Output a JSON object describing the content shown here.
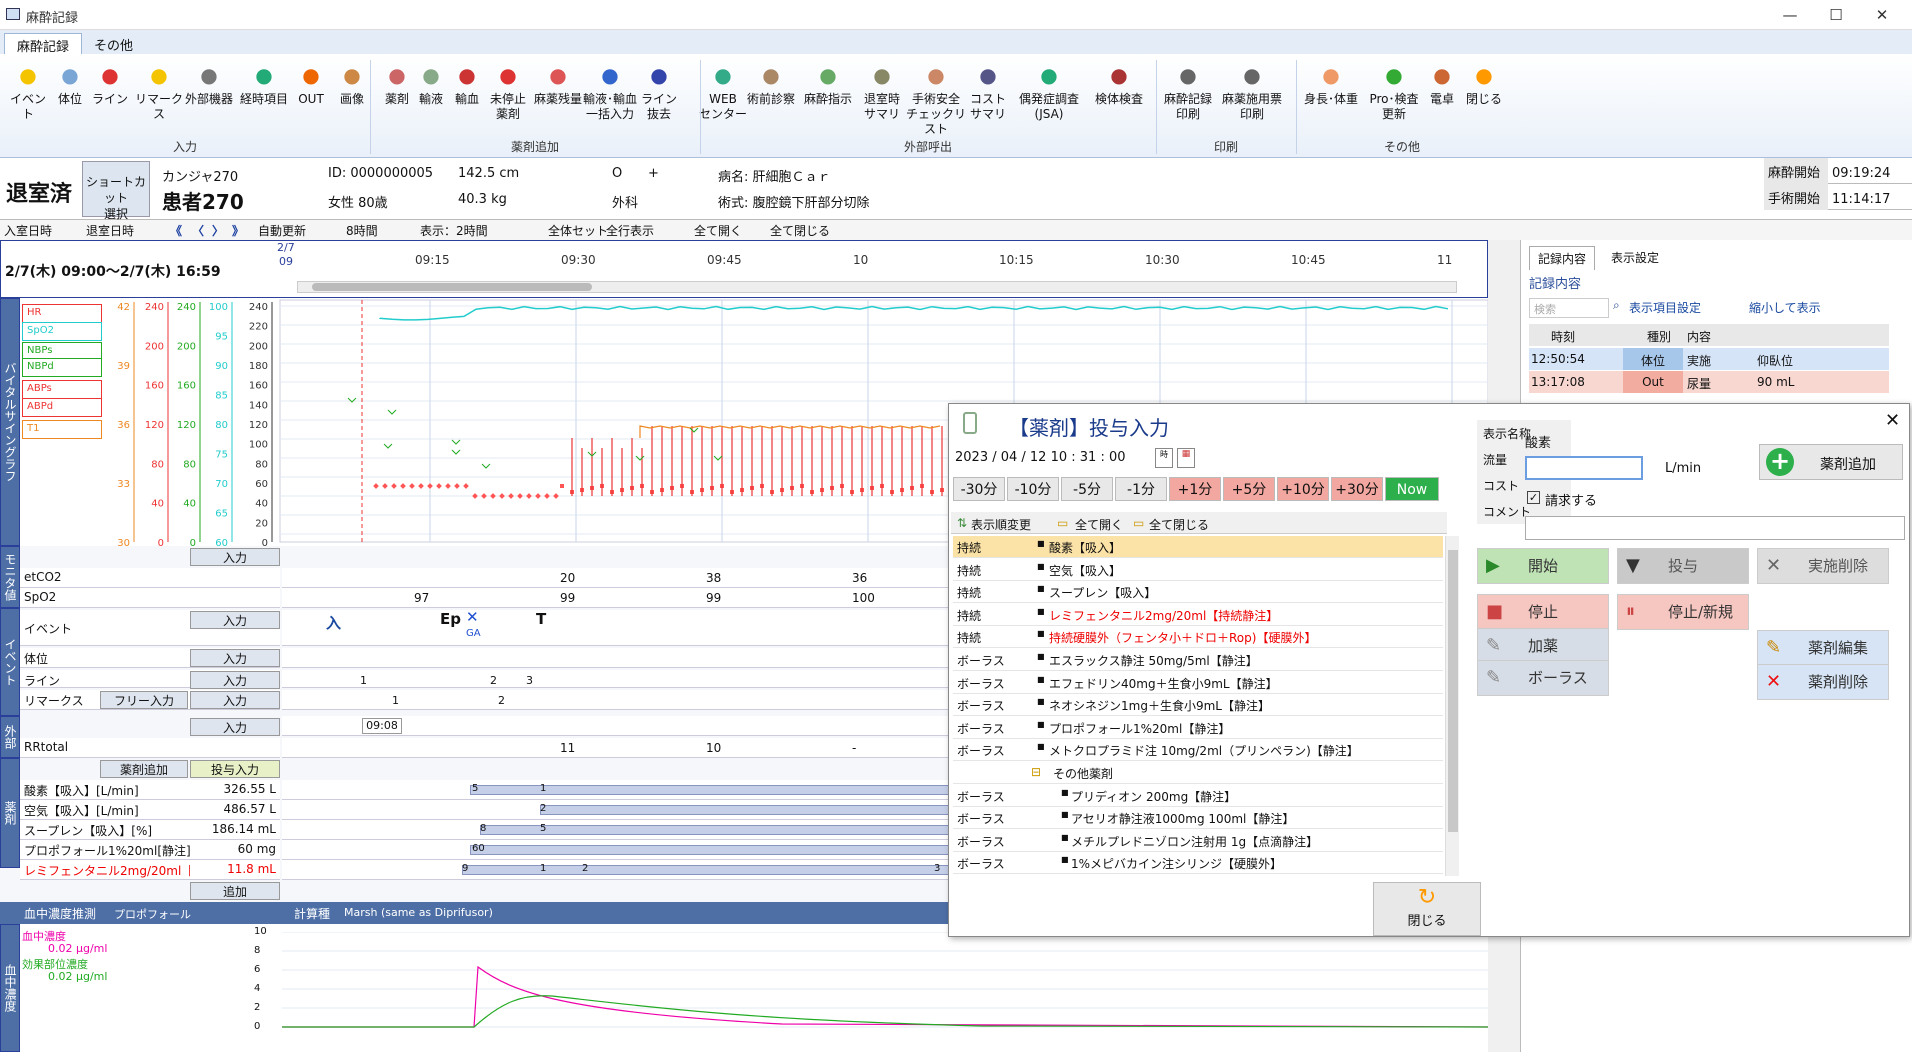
{
  "window": {
    "title": "麻酔記録",
    "minimize": "—",
    "maximize": "☐",
    "close": "✕"
  },
  "ribbon": {
    "tabs": [
      "麻酔記録",
      "その他"
    ],
    "buttons": [
      {
        "label": "イベント",
        "icon": "flag-icon",
        "color": "#f5c400"
      },
      {
        "label": "体位",
        "icon": "bed-icon",
        "color": "#7aa6d6"
      },
      {
        "label": "ライン",
        "icon": "line-icon",
        "color": "#d33"
      },
      {
        "label": "リマークス",
        "icon": "flag-icon",
        "color": "#f5c400"
      },
      {
        "label": "外部機器",
        "icon": "device-icon",
        "color": "#777"
      },
      {
        "label": "経時項目",
        "icon": "check-icon",
        "color": "#2a7"
      },
      {
        "label": "OUT",
        "icon": "drop-icon",
        "color": "#e60"
      },
      {
        "label": "画像",
        "icon": "palette-icon",
        "color": "#c84"
      },
      {
        "label": "薬剤",
        "icon": "bottle-icon",
        "color": "#c66"
      },
      {
        "label": "輸液",
        "icon": "iv-icon",
        "color": "#8a8"
      },
      {
        "label": "輸血",
        "icon": "blood-icon",
        "color": "#c33"
      },
      {
        "label": "未停止\n薬剤",
        "icon": "syringe-icon",
        "color": "#d33"
      },
      {
        "label": "麻薬残量",
        "icon": "calendar-icon",
        "color": "#d55"
      },
      {
        "label": "輸液･輸血\n一括入力",
        "icon": "bag-icon",
        "color": "#36c"
      },
      {
        "label": "ライン\n抜去",
        "icon": "line-remove-icon",
        "color": "#34a"
      },
      {
        "label": "WEB\nセンター",
        "icon": "web-icon",
        "color": "#3a8"
      },
      {
        "label": "術前診察",
        "icon": "doctor-icon",
        "color": "#a86"
      },
      {
        "label": "麻酔指示",
        "icon": "syringe-icon",
        "color": "#6a6"
      },
      {
        "label": "退室時\nサマリ",
        "icon": "note-icon",
        "color": "#886"
      },
      {
        "label": "手術安全\nチェックリスト",
        "icon": "nurse-icon",
        "color": "#c86"
      },
      {
        "label": "コスト\nサマリ",
        "icon": "cost-icon",
        "color": "#558"
      },
      {
        "label": "偶発症調査\n(JSA)",
        "icon": "check-icon",
        "color": "#2a7"
      },
      {
        "label": "検体検査",
        "icon": "lab-icon",
        "color": "#a33"
      },
      {
        "label": "麻酔記録\n印刷",
        "icon": "printer-icon",
        "color": "#666"
      },
      {
        "label": "麻薬施用票\n印刷",
        "icon": "printer-icon",
        "color": "#666"
      },
      {
        "label": "身長･体重",
        "icon": "person-icon",
        "color": "#e96"
      },
      {
        "label": "Pro･検査\n更新",
        "icon": "refresh-icon",
        "color": "#3a3"
      },
      {
        "label": "電卓",
        "icon": "calculator-icon",
        "color": "#c63"
      },
      {
        "label": "閉じる",
        "icon": "close-arrow-icon",
        "color": "#f90"
      }
    ],
    "groups": [
      "入力",
      "薬剤追加",
      "外部呼出",
      "印刷",
      "その他"
    ]
  },
  "patient": {
    "status": "退室済",
    "shortcut": "ショートカット\n選択",
    "kana": "カンジャ270",
    "name": "患者270",
    "id": "ID: 0000000005",
    "sex_age": "女性  80歳",
    "height": "142.5 cm",
    "weight": "40.3 kg",
    "blood": "O",
    "rh": "+",
    "dept": "外科",
    "disease": "病名: 肝細胞Ｃａｒ",
    "surgery": "術式: 腹腔鏡下肝部分切除",
    "anes_start_label": "麻酔開始",
    "anes_start": "09:19:24",
    "op_start_label": "手術開始",
    "op_start": "11:14:17"
  },
  "toolbar": {
    "items": [
      "入室日時",
      "退室日時",
      "《",
      "〈",
      "〉",
      "》",
      "自動更新",
      "8時間",
      "表示：2時間",
      "全体セット",
      "全行表示",
      "全て開く",
      "全て閉じる"
    ]
  },
  "timeline": {
    "range": "2/7(木) 09:00～2/7(木) 16:59",
    "date": "2/7",
    "ticks": [
      "09",
      "09:15",
      "09:30",
      "09:45",
      "10",
      "10:15",
      "10:30",
      "10:45",
      "11"
    ]
  },
  "vital": {
    "side": "バイタルサイングラフ",
    "legend": [
      "HR",
      "SpO2",
      "NBPs",
      "NBPd",
      "ABPs",
      "ABPd",
      "T1"
    ],
    "ax1": [
      "42",
      "39",
      "36",
      "33",
      "30"
    ],
    "ax2": [
      "240",
      "200",
      "160",
      "120",
      "80",
      "40",
      "0"
    ],
    "ax3": [
      "240",
      "200",
      "160",
      "120",
      "80",
      "40",
      "0"
    ],
    "ax4": [
      "100",
      "95",
      "90",
      "85",
      "80",
      "75",
      "70",
      "65",
      "60"
    ],
    "ax5": [
      "240",
      "220",
      "200",
      "180",
      "160",
      "140",
      "120",
      "100",
      "80",
      "60",
      "40",
      "20",
      "0"
    ]
  },
  "monitor": {
    "side": "モニタ値",
    "add": "入力",
    "rows": [
      {
        "label": "etCO2",
        "vals": [
          "20",
          "38",
          "36"
        ]
      },
      {
        "label": "SpO2",
        "vals": [
          "97",
          "99",
          "99",
          "100"
        ]
      }
    ]
  },
  "event": {
    "side": "イベント",
    "rows": [
      {
        "label": "イベント",
        "btn": "入力"
      },
      {
        "label": "体位",
        "btn": "入力"
      },
      {
        "label": "ライン",
        "btn": "入力"
      },
      {
        "label": "リマークス",
        "btn": "入力",
        "free": "フリー入力"
      }
    ],
    "marks": [
      "入",
      "Ep",
      "✕",
      "T"
    ],
    "sub": "GA",
    "line_nums": [
      "1",
      "2",
      "3"
    ],
    "remark_nums": [
      "1",
      "2"
    ]
  },
  "external": {
    "side": "外部",
    "btn": "入力",
    "time": "09:08",
    "rr": "RRtotal",
    "rrvals": [
      "11",
      "10",
      "-"
    ]
  },
  "drugs": {
    "side": "薬剤",
    "add_btn": "薬剤追加",
    "dose_btn": "投与入力",
    "addrow": "追加",
    "rows": [
      {
        "name": "酸素【吸入】[L/min]",
        "total": "326.55 L",
        "nums": [
          "5",
          "1"
        ]
      },
      {
        "name": "空気【吸入】[L/min]",
        "total": "486.57 L",
        "nums": [
          "2"
        ]
      },
      {
        "name": "スープレン【吸入】[%]",
        "total": "186.14 mL",
        "nums": [
          "8",
          "5"
        ]
      },
      {
        "name": "プロポフォール1%20ml[静注] [",
        "total": "60 mg",
        "nums": [
          "60"
        ]
      },
      {
        "name": "レミフェンタニル2mg/20ml【持続",
        "total": "11.8 mL",
        "nums": [
          "9",
          "1",
          "2",
          "3"
        ]
      }
    ]
  },
  "blood": {
    "side": "血中濃度",
    "title": "血中濃度推測",
    "drug": "プロポフォール",
    "calc": "計算種",
    "model": "Marsh (same as Diprifusor)",
    "l1": "血中濃度",
    "v1": "0.02  μg/ml",
    "l2": "効果部位濃度",
    "v2": "0.02  μg/ml",
    "ax": [
      "10",
      "8",
      "6",
      "4",
      "2",
      "0"
    ]
  },
  "right": {
    "tabs": [
      "記録内容",
      "表示設定"
    ],
    "sub": "記録内容",
    "search": "検索",
    "disp": "表示項目設定",
    "shrink": "縮小して表示",
    "cols": [
      "時刻",
      "種別",
      "内容"
    ],
    "rows": [
      {
        "t": "12:50:54",
        "k": "体位",
        "c": "実施",
        "v": "仰臥位"
      },
      {
        "t": "13:17:08",
        "k": "Out",
        "c": "尿量",
        "v": "90 mL"
      }
    ]
  },
  "dialog": {
    "title": "【薬剤】投与入力",
    "datetime": "2023 / 04 / 12    10 : 31 : 00",
    "add": "薬剤追加",
    "times": [
      "-30分",
      "-10分",
      "-5分",
      "-1分",
      "+1分",
      "+5分",
      "+10分",
      "+30分",
      "Now"
    ],
    "list_btns": [
      "表示順変更",
      "全て開く",
      "全て閉じる"
    ],
    "list": [
      {
        "k": "持続",
        "v": "酸素【吸入】",
        "c": "#111"
      },
      {
        "k": "持続",
        "v": "空気【吸入】",
        "c": "#111"
      },
      {
        "k": "持続",
        "v": "スープレン【吸入】",
        "c": "#111"
      },
      {
        "k": "持続",
        "v": "レミフェンタニル2mg/20ml【持続静注】",
        "c": "#e00"
      },
      {
        "k": "持続",
        "v": "持続硬膜外（フェンタ小＋ドロ＋Rop)【硬膜外】",
        "c": "#e00"
      },
      {
        "k": "ボーラス",
        "v": "エスラックス静注 50mg/5ml【静注】",
        "c": "#111"
      },
      {
        "k": "ボーラス",
        "v": "エフェドリン40mg＋生食小9mL【静注】",
        "c": "#111"
      },
      {
        "k": "ボーラス",
        "v": "ネオシネジン1mg＋生食小9mL【静注】",
        "c": "#111"
      },
      {
        "k": "ボーラス",
        "v": "プロポフォール1%20ml【静注】",
        "c": "#111"
      },
      {
        "k": "ボーラス",
        "v": "メトクロプラミド注 10mg/2ml（プリンペラン)【静注】",
        "c": "#111"
      },
      {
        "k": "",
        "v": "その他薬剤",
        "c": "#111"
      },
      {
        "k": "ボーラス",
        "v": "プリディオン 200mg【静注】",
        "c": "#111"
      },
      {
        "k": "ボーラス",
        "v": "アセリオ静注液1000mg 100ml【静注】",
        "c": "#111"
      },
      {
        "k": "ボーラス",
        "v": "メチルプレドニゾロン注射用 1g【点滴静注】",
        "c": "#111"
      },
      {
        "k": "ボーラス",
        "v": "1%メピバカイン注シリンジ【硬膜外】",
        "c": "#111"
      }
    ],
    "fields": [
      {
        "l": "表示名称",
        "v": "酸素"
      },
      {
        "l": "流量",
        "v": "",
        "unit": "L/min"
      },
      {
        "l": "コスト",
        "v": "請求する"
      },
      {
        "l": "コメント",
        "v": ""
      }
    ],
    "actions": [
      "開始",
      "投与",
      "実施削除",
      "停止",
      "停止/新規",
      "加薬",
      "ボーラス",
      "薬剤編集",
      "薬剤削除"
    ],
    "close": "閉じる"
  }
}
